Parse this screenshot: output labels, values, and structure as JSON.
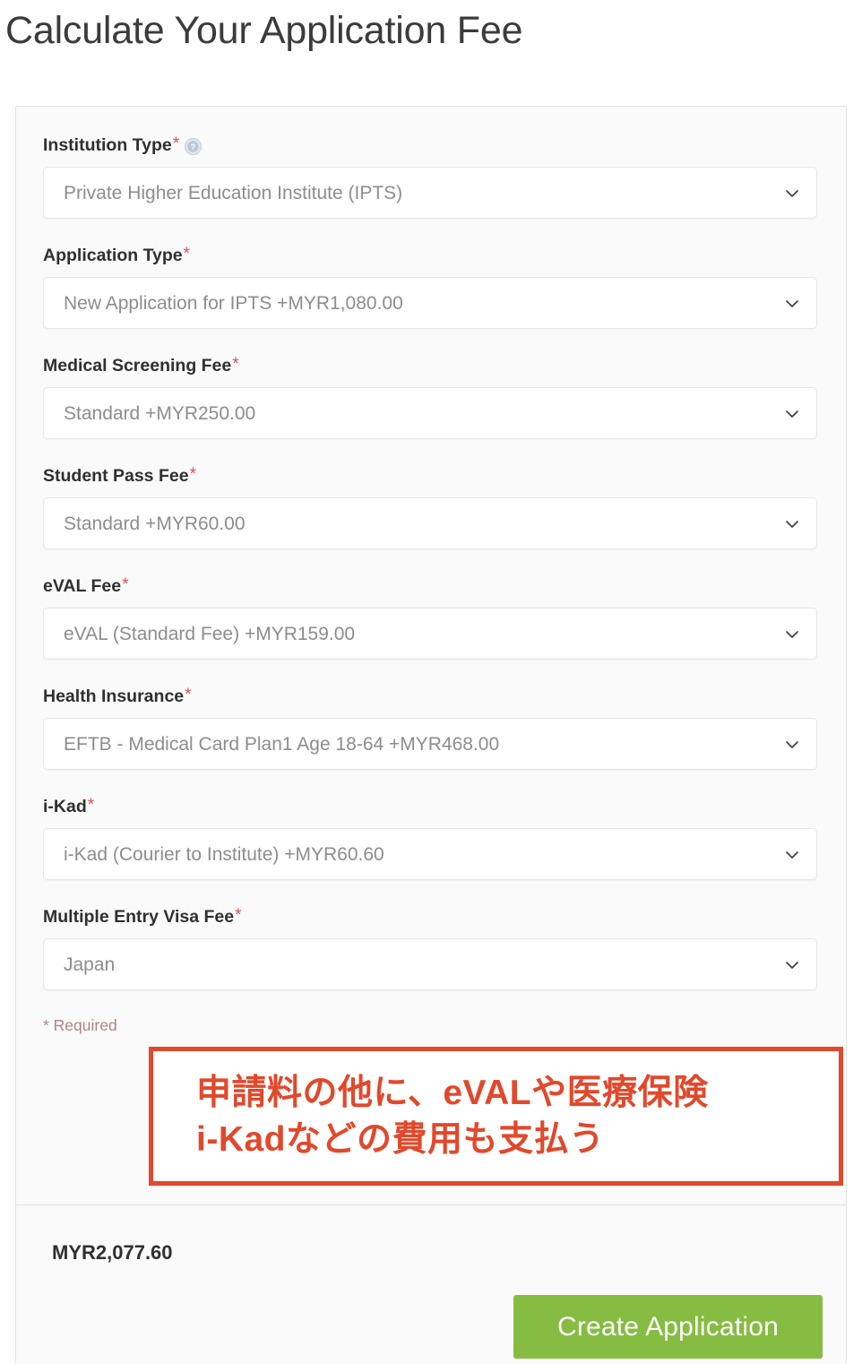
{
  "page": {
    "title": "Calculate Your Application Fee"
  },
  "form": {
    "fields": [
      {
        "label": "Institution Type",
        "required": true,
        "required_marker": "*",
        "has_help_icon": true,
        "help_icon_name": "question-mark-help-icon",
        "value": "Private Higher Education Institute (IPTS)",
        "chevron_icon": "chevron-down-icon"
      },
      {
        "label": "Application Type",
        "required": true,
        "required_marker": "*",
        "has_help_icon": false,
        "value": "New Application for IPTS +MYR1,080.00",
        "chevron_icon": "chevron-down-icon"
      },
      {
        "label": "Medical Screening Fee",
        "required": true,
        "required_marker": "*",
        "has_help_icon": false,
        "value": "Standard +MYR250.00",
        "chevron_icon": "chevron-down-icon"
      },
      {
        "label": "Student Pass Fee",
        "required": true,
        "required_marker": "*",
        "has_help_icon": false,
        "value": "Standard +MYR60.00",
        "chevron_icon": "chevron-down-icon"
      },
      {
        "label": "eVAL Fee",
        "required": true,
        "required_marker": "*",
        "has_help_icon": false,
        "value": "eVAL (Standard Fee) +MYR159.00",
        "chevron_icon": "chevron-down-icon"
      },
      {
        "label": "Health Insurance",
        "required": true,
        "required_marker": "*",
        "has_help_icon": false,
        "value": "EFTB - Medical Card Plan1 Age 18-64 +MYR468.00",
        "chevron_icon": "chevron-down-icon"
      },
      {
        "label": "i-Kad",
        "required": true,
        "required_marker": "*",
        "has_help_icon": false,
        "value": "i-Kad (Courier to Institute) +MYR60.60",
        "chevron_icon": "chevron-down-icon"
      },
      {
        "label": "Multiple Entry Visa Fee",
        "required": true,
        "required_marker": "*",
        "has_help_icon": false,
        "value": "Japan",
        "chevron_icon": "chevron-down-icon"
      }
    ],
    "required_note": "* Required"
  },
  "annotation": {
    "line1": "申請料の他に、eVALや医療保険",
    "line2": "i-Kadなどの費用も支払う",
    "border_color": "#e2482b",
    "text_color": "#e2482b"
  },
  "footer": {
    "total": "MYR2,077.60",
    "submit_label": "Create Application",
    "submit_color": "#86bc42"
  },
  "colors": {
    "title": "#3b3b3b",
    "label": "#2f2f2f",
    "value": "#8d8d8d",
    "required_star": "#d9534f",
    "required_note": "#b08484",
    "card_bg": "#fafafa",
    "card_border": "#e3e3e3",
    "input_bg": "#ffffff",
    "input_border": "#e6e6e6"
  }
}
